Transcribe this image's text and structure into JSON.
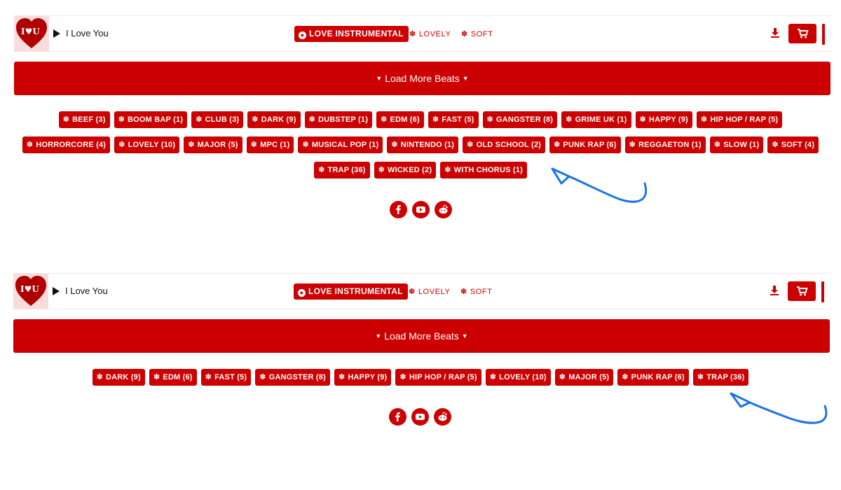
{
  "colors": {
    "brand": "#cc0000",
    "annotation": "#1a73e8"
  },
  "panels": [
    {
      "track": {
        "cover_text": "I♥U",
        "title": "I Love You",
        "primary_tag": "LOVE INSTRUMENTAL",
        "tags": [
          "LOVELY",
          "SOFT"
        ]
      },
      "load_more_label": "Load More Beats",
      "chip_rows": [
        [
          "BEEF (3)",
          "BOOM BAP (1)",
          "CLUB (3)",
          "DARK (9)",
          "DUBSTEP (1)",
          "EDM (6)",
          "FAST (5)",
          "GANGSTER (8)",
          "GRIME UK (1)",
          "HAPPY (9)",
          "HIP HOP / RAP (5)"
        ],
        [
          "HORRORCORE (4)",
          "LOVELY (10)",
          "MAJOR (5)",
          "MPC (1)",
          "MUSICAL POP (1)",
          "NINTENDO (1)",
          "OLD SCHOOL (2)",
          "PUNK RAP (6)",
          "REGGAETON (1)",
          "SLOW (1)",
          "SOFT (4)"
        ],
        [
          "TRAP (36)",
          "WICKED (2)",
          "WITH CHORUS (1)"
        ]
      ],
      "socials": [
        "facebook-icon",
        "youtube-icon",
        "reddit-icon"
      ]
    },
    {
      "track": {
        "cover_text": "I♥U",
        "title": "I Love You",
        "primary_tag": "LOVE INSTRUMENTAL",
        "tags": [
          "LOVELY",
          "SOFT"
        ]
      },
      "load_more_label": "Load More Beats",
      "chip_rows": [
        [
          "DARK (9)",
          "EDM (6)",
          "FAST (5)",
          "GANGSTER (8)",
          "HAPPY (9)",
          "HIP HOP / RAP (5)",
          "LOVELY (10)",
          "MAJOR (5)",
          "PUNK RAP (6)",
          "TRAP (36)"
        ]
      ],
      "socials": [
        "facebook-icon",
        "youtube-icon",
        "reddit-icon"
      ]
    }
  ]
}
